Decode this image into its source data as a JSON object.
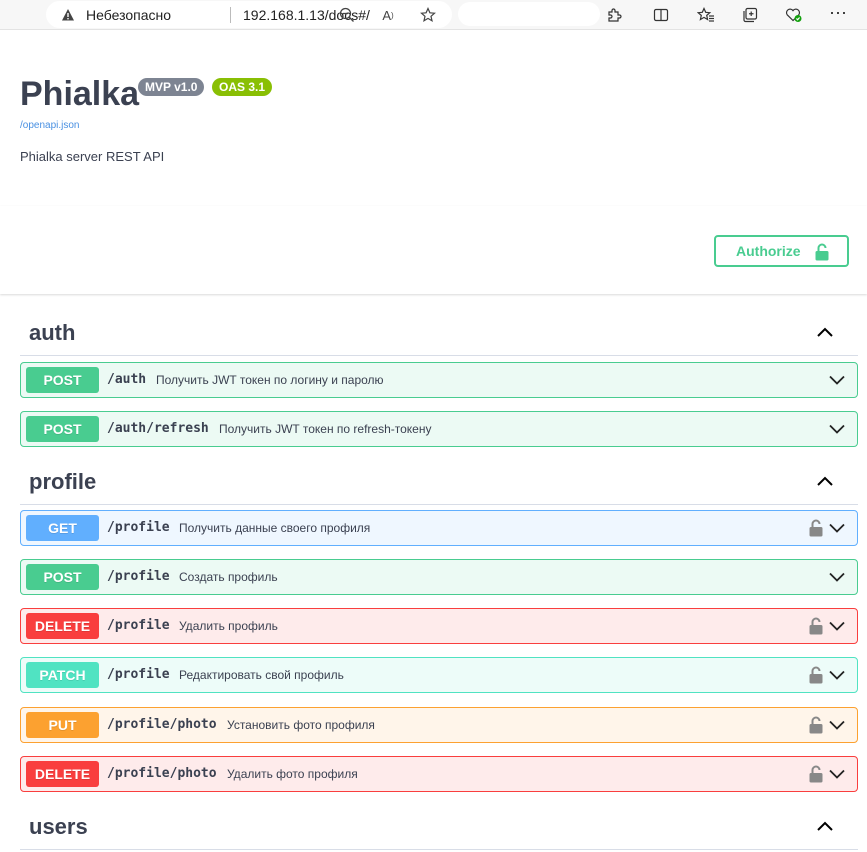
{
  "browser": {
    "security_label": "Небезопасно",
    "url": "192.168.1.13/docs#/",
    "icons": [
      "warning-icon",
      "zoom-out-icon",
      "read-aloud-icon",
      "favorite-star-icon",
      "extensions-icon",
      "split-screen-icon",
      "favorites-icon",
      "collections-icon",
      "browser-essentials-icon",
      "more-icon"
    ]
  },
  "info": {
    "title": "Phialka",
    "version_badge": "MVP v1.0",
    "oas_badge": "OAS 3.1",
    "spec_link": "/openapi.json",
    "description": "Phialka server REST API"
  },
  "authorize": {
    "label": "Authorize"
  },
  "tags": [
    {
      "name": "auth",
      "operations": [
        {
          "method": "POST",
          "path": "/auth",
          "summary": "Получить JWT токен по логину и паролю",
          "locked": false
        },
        {
          "method": "POST",
          "path": "/auth/refresh",
          "summary": "Получить JWT токен по refresh-токену",
          "locked": false
        }
      ]
    },
    {
      "name": "profile",
      "operations": [
        {
          "method": "GET",
          "path": "/profile",
          "summary": "Получить данные своего профиля",
          "locked": true
        },
        {
          "method": "POST",
          "path": "/profile",
          "summary": "Создать профиль",
          "locked": false
        },
        {
          "method": "DELETE",
          "path": "/profile",
          "summary": "Удалить профиль",
          "locked": true
        },
        {
          "method": "PATCH",
          "path": "/profile",
          "summary": "Редактировать свой профиль",
          "locked": true
        },
        {
          "method": "PUT",
          "path": "/profile/photo",
          "summary": "Установить фото профиля",
          "locked": true
        },
        {
          "method": "DELETE",
          "path": "/profile/photo",
          "summary": "Удалить фото профиля",
          "locked": true
        }
      ]
    },
    {
      "name": "users",
      "operations": []
    }
  ],
  "colors": {
    "post": "#49cc90",
    "get": "#61affe",
    "delete": "#f93e3e",
    "patch": "#50e3c2",
    "put": "#fca130",
    "badge_version": "#7d8492",
    "badge_oas": "#89bf04"
  }
}
